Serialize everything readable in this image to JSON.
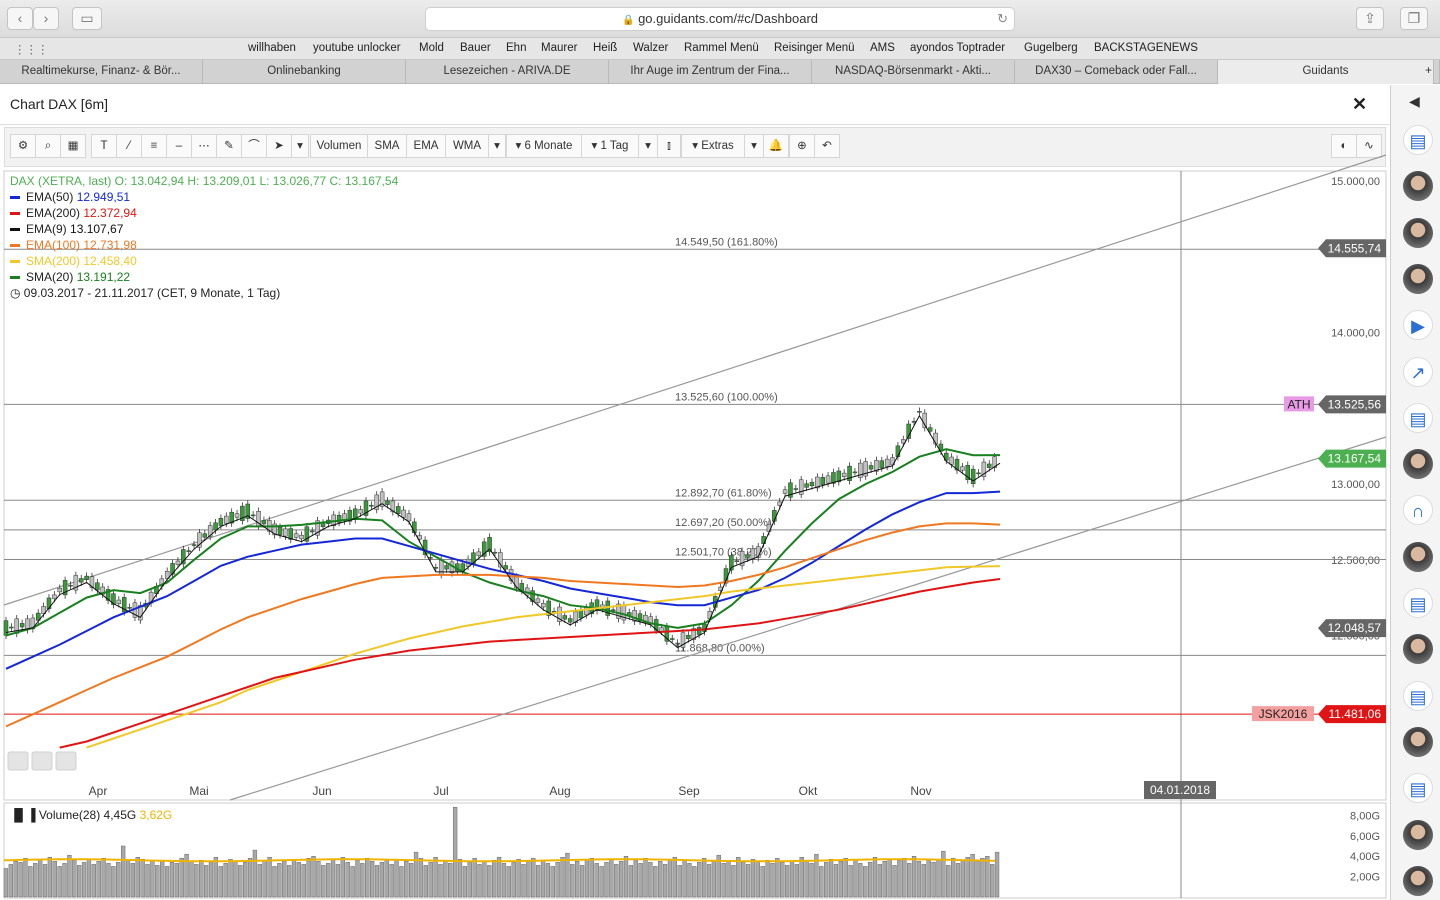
{
  "browser": {
    "url": "go.guidants.com/#c/Dashboard",
    "bookmarks": [
      "willhaben",
      "youtube unlocker",
      "Mold",
      "Bauer",
      "Ehn",
      "Maurer",
      "Heiß",
      "Walzer",
      "Rammel Menü",
      "Reisinger Menü",
      "AMS",
      "ayondos Toptrader",
      "Gugelberg",
      "BACKSTAGENEWS"
    ],
    "tabs": [
      "Realtimekurse, Finanz- & Bör...",
      "Onlinebanking",
      "Lesezeichen - ARIVA.DE",
      "Ihr Auge im Zentrum der Fina...",
      "NASDAQ-Börsenmarkt - Akti...",
      "DAX30 – Comeback oder Fall...",
      "Guidants"
    ]
  },
  "panel": {
    "title": "Chart DAX [6m]"
  },
  "toolbar": {
    "volumen": "Volumen",
    "sma": "SMA",
    "ema": "EMA",
    "wma": "WMA",
    "range": "6 Monate",
    "interval": "1 Tag",
    "extras": "Extras"
  },
  "colors": {
    "price": "#4caf50",
    "ema50": "#1428d8",
    "ema200": "#e01414",
    "ema9": "#111111",
    "ema100": "#f07820",
    "sma200": "#f0c828",
    "sma20": "#18801e",
    "vol_avg": "#f0b400"
  },
  "legend": [
    {
      "text": "DAX (XETRA, last)  O: 13.042,94  H: 13.209,01  L: 13.026,77  C: 13.167,54",
      "color": "#4caf50"
    },
    {
      "text": "EMA(50)",
      "value": "12.949,51",
      "color": "#1428d8"
    },
    {
      "text": "EMA(200)",
      "value": "12.372,94",
      "color": "#e01414"
    },
    {
      "text": "EMA(9)",
      "value": "13.107,67",
      "color": "#111111"
    },
    {
      "text": "EMA(100)",
      "value": "12.731,98",
      "color": "#f07820"
    },
    {
      "text": "SMA(200)",
      "value": "12.458,40",
      "color": "#f0c828"
    },
    {
      "text": "SMA(20)",
      "value": "13.191,22",
      "color": "#18801e"
    },
    {
      "text": "09.03.2017 - 21.11.2017   (CET, 9 Monate, 1 Tag)",
      "color": "#222222"
    }
  ],
  "chart_data": {
    "type": "line",
    "title": "Chart DAX [6m]",
    "xlabel": "",
    "ylabel": "",
    "ylim": [
      11250,
      15050
    ],
    "x_ticks": [
      "Apr",
      "Mai",
      "Jun",
      "Jul",
      "Aug",
      "Sep",
      "Okt",
      "Nov"
    ],
    "y_ticks": [
      "15.000,00",
      "14.000,00",
      "13.000,00",
      "12.500,00",
      "12.000,00"
    ],
    "price_labels": [
      {
        "text": "14.555,74",
        "value": 14555.74,
        "color": "#666666"
      },
      {
        "text": "13.525,56",
        "value": 13525.56,
        "color": "#666666"
      },
      {
        "text": "13.167,54",
        "value": 13167.54,
        "color": "#4caf50"
      },
      {
        "text": "12.048,57",
        "value": 12048.57,
        "color": "#666666"
      },
      {
        "text": "11.481,06",
        "value": 11481.06,
        "color": "#e01414"
      }
    ],
    "tags": [
      {
        "text": "ATH",
        "value": 13525.56,
        "color": "#e89ae6"
      },
      {
        "text": "JSK2016",
        "value": 11481.06,
        "color": "#f4a0a0"
      }
    ],
    "crosshair_date": "04.01.2018",
    "fib_levels": [
      {
        "text": "14.549,50 (161.80%)",
        "value": 14549.5
      },
      {
        "text": "13.525,60 (100.00%)",
        "value": 13525.6
      },
      {
        "text": "12.892,70 (61.80%)",
        "value": 12892.7
      },
      {
        "text": "12.697,20 (50.00%)",
        "value": 12697.2
      },
      {
        "text": "12.501,70 (38.20%)",
        "value": 12501.7
      },
      {
        "text": "11.868,80 (0.00%)",
        "value": 11868.8
      }
    ],
    "series": [
      {
        "name": "DAX (XETRA, last)",
        "values": [
          12050,
          12080,
          12300,
          12380,
          12240,
          12150,
          12400,
          12600,
          12750,
          12820,
          12700,
          12650,
          12750,
          12800,
          12900,
          12780,
          12450,
          12450,
          12600,
          12350,
          12200,
          12100,
          12200,
          12150,
          12100,
          11950,
          12050,
          12480,
          12550,
          12950,
          13000,
          13050,
          13100,
          13150,
          13480,
          13180,
          13050,
          13167
        ]
      },
      {
        "name": "SMA(20)",
        "values": [
          12000,
          12050,
          12150,
          12250,
          12300,
          12280,
          12350,
          12500,
          12640,
          12720,
          12720,
          12730,
          12750,
          12770,
          12760,
          12620,
          12520,
          12420,
          12350,
          12300,
          12260,
          12200,
          12180,
          12140,
          12080,
          12050,
          12080,
          12200,
          12360,
          12560,
          12740,
          12900,
          13000,
          13080,
          13180,
          13230,
          13190,
          13191
        ]
      },
      {
        "name": "EMA(50)",
        "values": [
          11780,
          11860,
          11940,
          12030,
          12120,
          12190,
          12260,
          12360,
          12460,
          12520,
          12560,
          12600,
          12620,
          12640,
          12640,
          12590,
          12540,
          12490,
          12440,
          12400,
          12360,
          12310,
          12280,
          12250,
          12220,
          12200,
          12200,
          12250,
          12300,
          12380,
          12480,
          12590,
          12700,
          12800,
          12880,
          12940,
          12940,
          12950
        ]
      },
      {
        "name": "EMA(100)",
        "values": [
          11400,
          11480,
          11560,
          11640,
          11720,
          11790,
          11860,
          11950,
          12040,
          12120,
          12180,
          12240,
          12290,
          12340,
          12380,
          12390,
          12400,
          12400,
          12400,
          12390,
          12380,
          12360,
          12350,
          12340,
          12330,
          12320,
          12330,
          12360,
          12400,
          12450,
          12510,
          12570,
          12630,
          12680,
          12720,
          12740,
          12740,
          12732
        ]
      },
      {
        "name": "SMA(200)",
        "values": [
          null,
          null,
          null,
          11260,
          11320,
          11380,
          11440,
          11500,
          11560,
          11640,
          11700,
          11760,
          11820,
          11880,
          11930,
          11980,
          12020,
          12060,
          12090,
          12120,
          12140,
          12160,
          12180,
          12200,
          12220,
          12240,
          12260,
          12290,
          12310,
          12330,
          12350,
          12370,
          12390,
          12410,
          12430,
          12450,
          12455,
          12458
        ]
      },
      {
        "name": "EMA(200)",
        "values": [
          null,
          null,
          11260,
          11300,
          11360,
          11420,
          11480,
          11540,
          11600,
          11660,
          11720,
          11760,
          11800,
          11840,
          11870,
          11900,
          11920,
          11940,
          11960,
          11970,
          11980,
          11990,
          12000,
          12010,
          12020,
          12030,
          12040,
          12060,
          12080,
          12110,
          12140,
          12170,
          12210,
          12250,
          12290,
          12320,
          12350,
          12373
        ]
      }
    ],
    "volume": {
      "label": "Volume(28)",
      "value": "4,45G",
      "avg": "3,62G",
      "y_ticks": [
        "8,00G",
        "6,00G",
        "4,00G",
        "2,00G"
      ],
      "bars": [
        2.8,
        3.2,
        3.5,
        3.4,
        3.8,
        3.0,
        3.3,
        3.6,
        3.2,
        3.9,
        3.5,
        3.0,
        3.3,
        4.1,
        3.6,
        3.1,
        3.4,
        3.7,
        3.2,
        3.5,
        3.8,
        3.3,
        3.0,
        3.4,
        5.0,
        3.6,
        3.3,
        3.9,
        3.7,
        3.2,
        3.6,
        3.1,
        3.5,
        3.0,
        3.4,
        3.3,
        3.8,
        4.2,
        3.5,
        3.2,
        3.6,
        3.1,
        3.4,
        3.9,
        3.0,
        3.3,
        3.7,
        3.5,
        3.1,
        3.4,
        3.8,
        4.6,
        3.2,
        3.6,
        3.9,
        3.0,
        3.3,
        3.5,
        3.1,
        3.6,
        3.4,
        3.2,
        3.8,
        4.0,
        3.5,
        3.1,
        3.3,
        3.7,
        3.2,
        3.9,
        3.4,
        3.0,
        3.6,
        3.3,
        3.8,
        3.5,
        3.1,
        3.4,
        3.7,
        3.2,
        3.6,
        3.0,
        3.5,
        3.3,
        4.4,
        3.8,
        3.1,
        3.4,
        3.9,
        3.2,
        3.6,
        3.3,
        8.8,
        3.7,
        3.0,
        3.4,
        3.8,
        3.2,
        3.5,
        3.1,
        3.6,
        3.9,
        3.3,
        3.0,
        3.4,
        3.7,
        3.2,
        3.5,
        3.8,
        3.1,
        3.6,
        3.3,
        3.0,
        3.4,
        3.9,
        4.3,
        3.2,
        3.5,
        3.1,
        3.6,
        3.8,
        3.3,
        3.0,
        3.4,
        3.7,
        3.2,
        3.5,
        4.0,
        3.1,
        3.6,
        3.3,
        3.8,
        3.4,
        3.0,
        3.5,
        3.2,
        3.7,
        3.9,
        3.1,
        3.6,
        3.3,
        3.0,
        3.4,
        3.8,
        3.2,
        3.5,
        4.1,
        3.3,
        3.6,
        3.1,
        3.9,
        3.4,
        3.2,
        3.7,
        3.5,
        3.0,
        3.6,
        3.3,
        3.8,
        3.4,
        3.1,
        3.5,
        3.2,
        3.9,
        3.6,
        3.3,
        4.2,
        3.0,
        3.4,
        3.7,
        3.2,
        3.5,
        3.8,
        3.1,
        3.6,
        3.3,
        3.0,
        3.4,
        3.9,
        3.2,
        3.5,
        3.7,
        3.1,
        3.6,
        3.8,
        3.3,
        4.0,
        3.5,
        3.2,
        3.6,
        3.4,
        3.7,
        4.5,
        3.1,
        3.8,
        3.3,
        3.6,
        3.9,
        4.2,
        3.5,
        3.8,
        4.0,
        3.2,
        4.4
      ]
    }
  }
}
